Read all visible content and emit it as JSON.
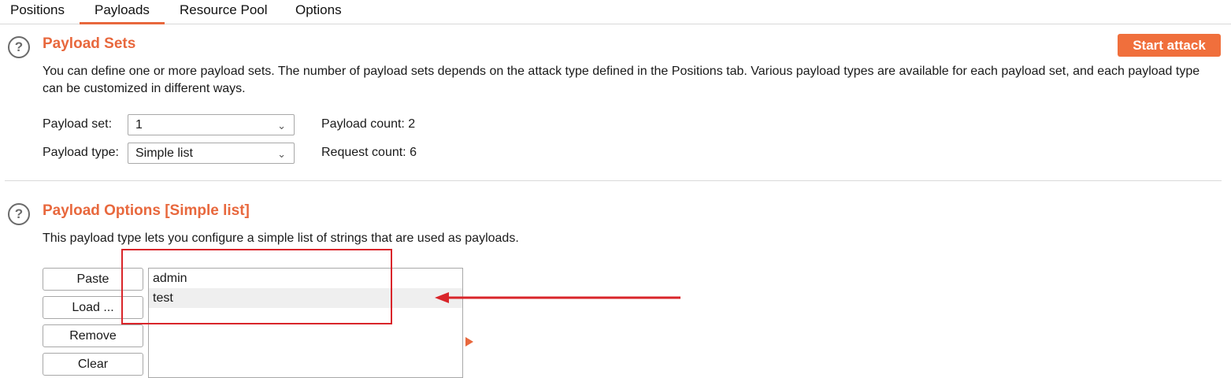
{
  "tabs": [
    {
      "label": "Positions"
    },
    {
      "label": "Payloads"
    },
    {
      "label": "Resource Pool"
    },
    {
      "label": "Options"
    }
  ],
  "payload_sets": {
    "title": "Payload Sets",
    "start_button": "Start attack",
    "description": "You can define one or more payload sets. The number of payload sets depends on the attack type defined in the Positions tab. Various payload types are available for each payload set, and each payload type can be customized in different ways.",
    "set_label": "Payload set:",
    "set_value": "1",
    "type_label": "Payload type:",
    "type_value": "Simple list",
    "payload_count": "Payload count: 2",
    "request_count": "Request count: 6"
  },
  "payload_options": {
    "title": "Payload Options [Simple list]",
    "description": "This payload type lets you configure a simple list of strings that are used as payloads.",
    "buttons": [
      "Paste",
      "Load ...",
      "Remove",
      "Clear"
    ],
    "items": [
      "admin",
      "test"
    ]
  },
  "colors": {
    "accent": "#e8683d",
    "annotation": "#d9252a"
  },
  "icons": {
    "help": "help-circle-icon",
    "dropdown": "chevron-down-icon"
  }
}
